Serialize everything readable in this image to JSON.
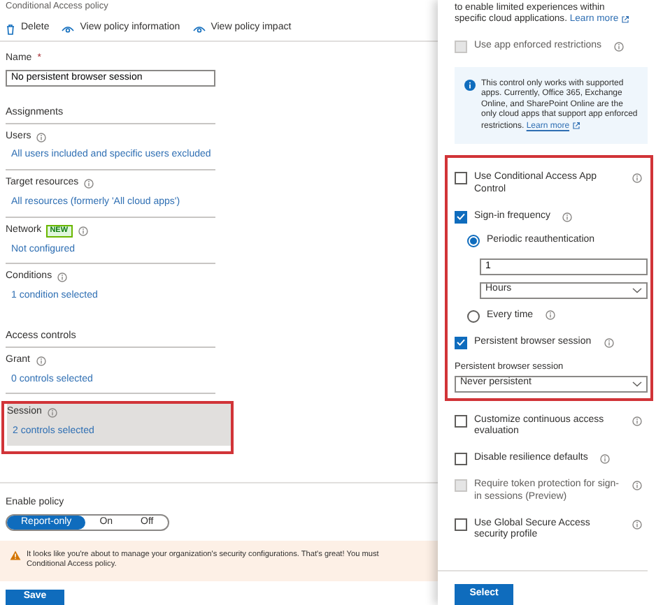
{
  "header": {
    "title": "Conditional Access policy"
  },
  "toolbar": [
    {
      "kind": "delete",
      "label": "Delete"
    },
    {
      "kind": "view",
      "label": "View policy information"
    },
    {
      "kind": "view",
      "label": "View policy impact"
    }
  ],
  "name_field": {
    "label": "Name",
    "required_mark": "*",
    "value": "No persistent browser session"
  },
  "sections": [
    {
      "heading": "Assignments",
      "items": [
        {
          "label": "Users",
          "info": true,
          "value": "All users included and specific users excluded",
          "selected": false
        },
        {
          "label": "Target resources",
          "info": true,
          "value": "All resources (formerly 'All cloud apps')",
          "selected": false
        },
        {
          "label": "Network",
          "badge": "NEW",
          "info": true,
          "value": "Not configured",
          "selected": false
        },
        {
          "label": "Conditions",
          "info": true,
          "value": "1 condition selected",
          "selected": false
        }
      ]
    },
    {
      "heading": "Access controls",
      "items": [
        {
          "label": "Grant",
          "info": true,
          "value": "0 controls selected",
          "selected": false
        },
        {
          "label": "Session",
          "info": true,
          "value": "2 controls selected",
          "selected": true,
          "highlighted": true
        }
      ]
    }
  ],
  "enable_policy": {
    "label": "Enable policy",
    "options": [
      {
        "label": "Report-only",
        "selected": true
      },
      {
        "label": "On",
        "selected": false
      },
      {
        "label": "Off",
        "selected": false
      }
    ]
  },
  "warning": {
    "lines": [
      "It looks like you're about to manage your organization's security configurations. That's great! You must",
      "Conditional Access policy."
    ]
  },
  "save_button": "Save",
  "panel": {
    "intro": [
      "to enable limited experiences within",
      "specific cloud applications."
    ],
    "intro_link": "Learn more",
    "controls": [
      {
        "kind": "checkbox",
        "label": "Use app enforced restrictions",
        "checked": false,
        "disabled": true,
        "info": true
      },
      {
        "kind": "note",
        "text": "This control only works with supported apps. Currently, Office 365, Exchange Online, and SharePoint Online are the only cloud apps that support app enforced restrictions.",
        "link": "Learn more"
      },
      {
        "kind": "highlight",
        "children": [
          {
            "kind": "checkbox",
            "label": "Use Conditional Access App Control",
            "checked": false,
            "disabled": false,
            "info": true
          },
          {
            "kind": "checkbox",
            "label": "Sign-in frequency",
            "checked": true,
            "disabled": false,
            "info": true,
            "children": [
              {
                "kind": "radio",
                "label": "Periodic reauthentication",
                "selected": true,
                "children": [
                  {
                    "kind": "textbox",
                    "value": "1"
                  },
                  {
                    "kind": "dropdown",
                    "value": "Hours"
                  }
                ]
              },
              {
                "kind": "radio",
                "label": "Every time",
                "selected": false,
                "info": true
              }
            ]
          },
          {
            "kind": "checkbox",
            "label": "Persistent browser session",
            "checked": true,
            "disabled": false,
            "info": true
          },
          {
            "kind": "dropdown",
            "label": "Persistent browser session",
            "value": "Never persistent"
          }
        ]
      },
      {
        "kind": "checkbox",
        "label": "Customize continuous access evaluation",
        "checked": false,
        "disabled": false,
        "info": true
      },
      {
        "kind": "checkbox",
        "label": "Disable resilience defaults",
        "checked": false,
        "disabled": false,
        "info": true
      },
      {
        "kind": "checkbox",
        "label": "Require token protection for sign-in sessions (Preview)",
        "checked": false,
        "disabled": true,
        "info": true
      },
      {
        "kind": "checkbox",
        "label": "Use Global Secure Access security profile",
        "checked": false,
        "disabled": false,
        "info": true
      }
    ]
  },
  "select_button": "Select"
}
